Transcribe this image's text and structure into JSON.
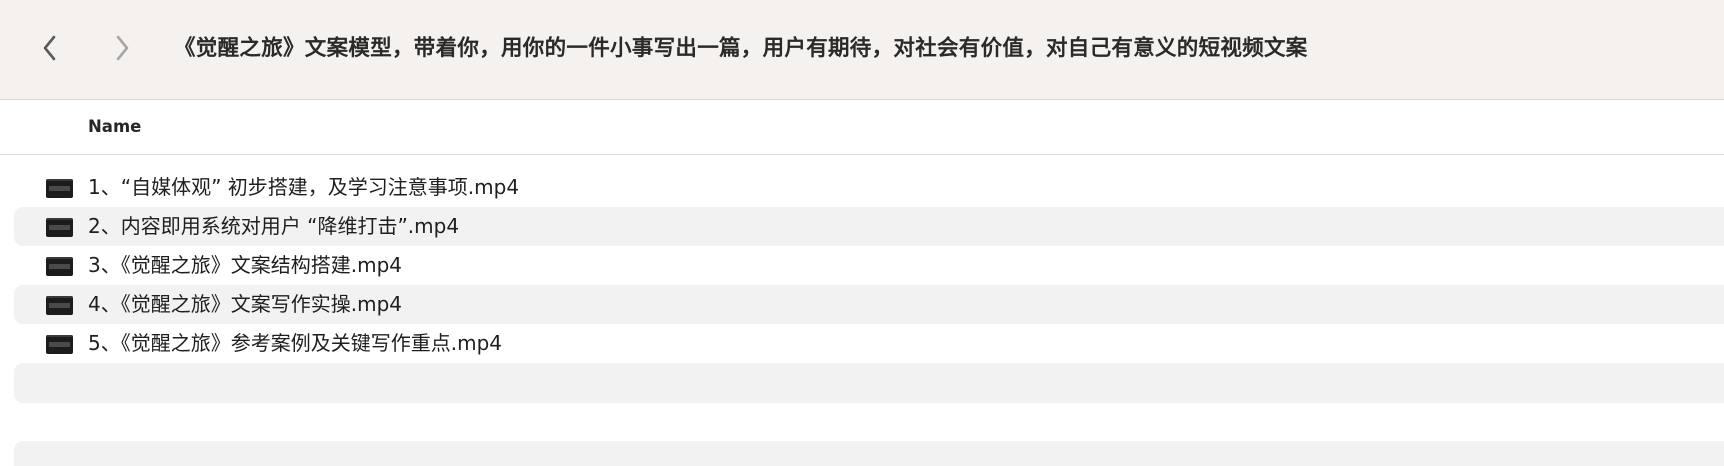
{
  "toolbar": {
    "back_icon": "chevron-left-icon",
    "forward_icon": "chevron-right-icon",
    "title": "《觉醒之旅》文案模型，带着你，用你的一件小事写出一篇，用户有期待，对社会有价值，对自己有意义的短视频文案"
  },
  "list_header": {
    "name_label": "Name"
  },
  "files": [
    {
      "name": "1、“自媒体观” 初步搭建，及学习注意事项.mp4",
      "icon": "video-file-icon"
    },
    {
      "name": "2、内容即用系统对用户 “降维打击”.mp4",
      "icon": "video-file-icon"
    },
    {
      "name": "3、《觉醒之旅》文案结构搭建.mp4",
      "icon": "video-file-icon"
    },
    {
      "name": "4、《觉醒之旅》文案写作实操.mp4",
      "icon": "video-file-icon"
    },
    {
      "name": "5、《觉醒之旅》参考案例及关键写作重点.mp4",
      "icon": "video-file-icon"
    }
  ],
  "colors": {
    "toolbar_bg": "#f5f1ee",
    "stripe": "#f2f2f2",
    "text": "#1f1f1f"
  }
}
